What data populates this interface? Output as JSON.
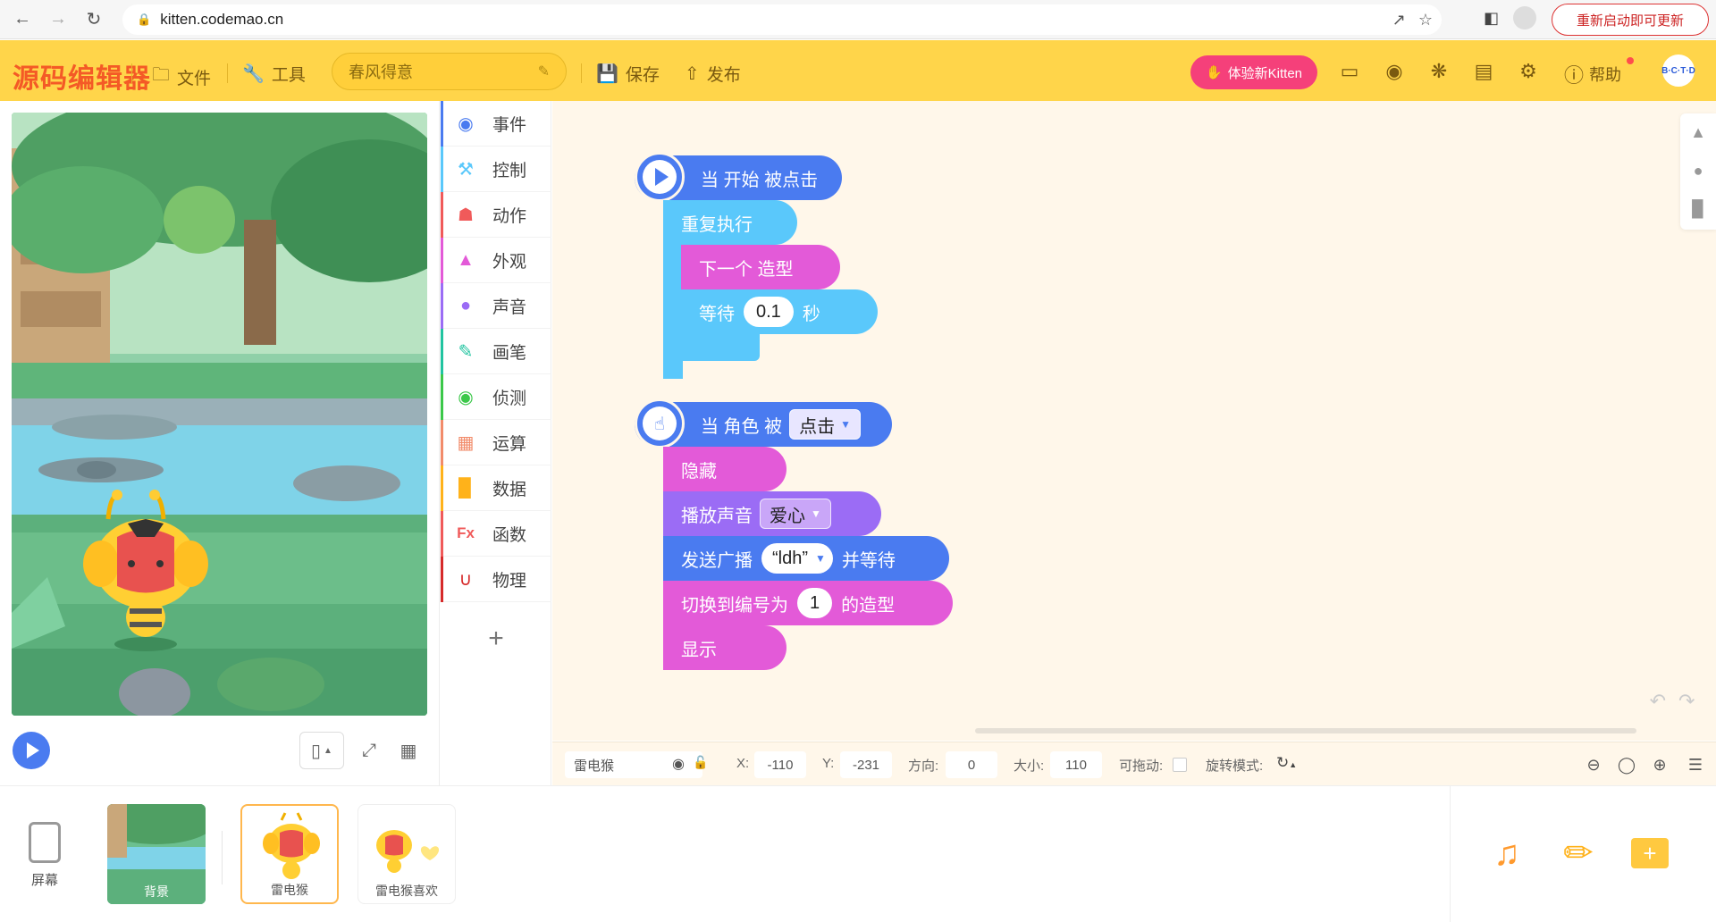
{
  "browser": {
    "url": "kitten.codemao.cn",
    "update_label": "重新启动即可更新"
  },
  "toolbar": {
    "logo": "源码编辑器",
    "file_label": "文件",
    "tools_label": "工具",
    "project_title": "春风得意",
    "save_label": "保存",
    "publish_label": "发布",
    "try_label": "体验新Kitten",
    "help_label": "帮助",
    "avatar_text": "B·C·T·D"
  },
  "categories": [
    {
      "label": "事件",
      "color": "#4a7bf0",
      "icon": "toggle-icon"
    },
    {
      "label": "控制",
      "color": "#5ac8fb",
      "icon": "gamepad-icon"
    },
    {
      "label": "动作",
      "color": "#f05a5a",
      "icon": "ghost-icon"
    },
    {
      "label": "外观",
      "color": "#e35ad8",
      "icon": "shirt-icon"
    },
    {
      "label": "声音",
      "color": "#9b6cf5",
      "icon": "microphone-icon"
    },
    {
      "label": "画笔",
      "color": "#21c4a0",
      "icon": "pen-icon"
    },
    {
      "label": "侦测",
      "color": "#3cc84a",
      "icon": "radar-icon"
    },
    {
      "label": "运算",
      "color": "#f28b6a",
      "icon": "calculator-icon"
    },
    {
      "label": "数据",
      "color": "#ffb21a",
      "icon": "bar-chart-icon"
    },
    {
      "label": "函数",
      "color": "#f05a5a",
      "icon": "function-icon"
    },
    {
      "label": "物理",
      "color": "#d62a2a",
      "icon": "magnet-icon"
    }
  ],
  "script1": {
    "hat": "当 开始 被点击",
    "repeat": "重复执行",
    "next_costume": "下一个 造型",
    "wait": "等待",
    "wait_value": "0.1",
    "wait_unit": "秒"
  },
  "script2": {
    "hat_prefix": "当 角色 被",
    "hat_option": "点击",
    "hide": "隐藏",
    "play_sound": "播放声音",
    "sound_option": "爱心",
    "broadcast": "发送广播",
    "broadcast_option": "“ldh”",
    "broadcast_suffix": "并等待",
    "switch_prefix": "切换到编号为",
    "switch_value": "1",
    "switch_suffix": "的造型",
    "show": "显示"
  },
  "props": {
    "sprite_name": "雷电猴",
    "x_label": "X:",
    "x_value": "-110",
    "y_label": "Y:",
    "y_value": "-231",
    "dir_label": "方向:",
    "dir_value": "0",
    "size_label": "大小:",
    "size_value": "110",
    "drag_label": "可拖动:",
    "rotation_label": "旋转模式:"
  },
  "bottom": {
    "screen_label": "屏幕",
    "bg_label": "背景",
    "sprites": [
      "雷电猴",
      "雷电猴喜欢"
    ]
  },
  "colors": {
    "toolbar": "#ffd54a",
    "event": "#4a7bf0",
    "control": "#5ac8fb",
    "looks": "#e35ad8",
    "sound": "#9b6cf5",
    "workspace": "#fff7ea"
  }
}
